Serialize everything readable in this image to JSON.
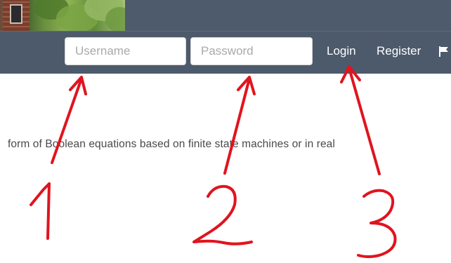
{
  "header": {
    "username": {
      "placeholder": "Username",
      "value": ""
    },
    "password": {
      "placeholder": "Password",
      "value": ""
    },
    "login_label": "Login",
    "register_label": "Register",
    "flag_icon": "flag-icon"
  },
  "content": {
    "text": "form of Boolean equations based on finite state machines or in real"
  },
  "annotations": {
    "color": "#e0141e",
    "labels": [
      "1",
      "2",
      "3"
    ],
    "targets": [
      "Username",
      "Password",
      "Login"
    ]
  }
}
